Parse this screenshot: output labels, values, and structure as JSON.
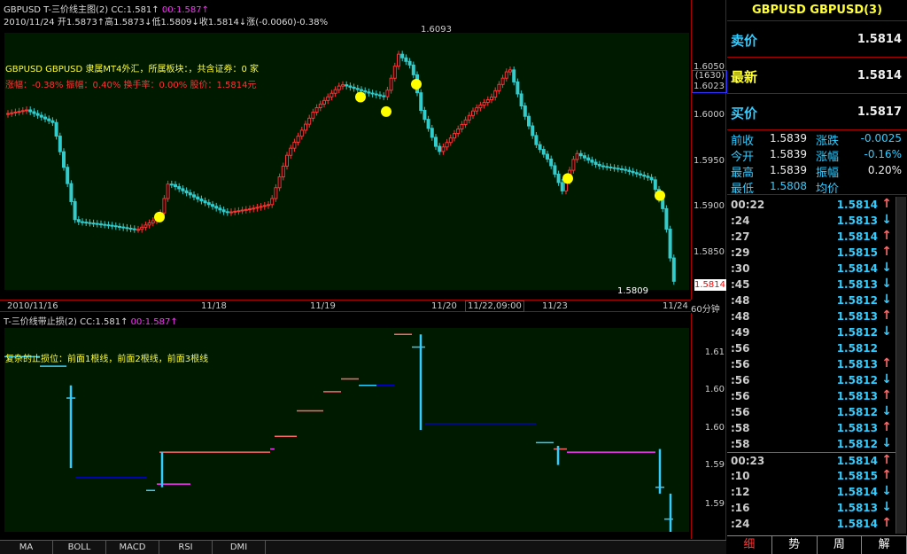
{
  "main": {
    "title": "GBPUSD T-三价线主图(2) CC:1.581↑",
    "title_cc2": "00:1.587↑",
    "ohlc": "2010/11/24 开1.5873↑高1.5873↓低1.5809↓收1.5814↓涨(-0.0060)-0.38%",
    "info_line": "GBPUSD GBPUSD 隶属MT4外汇，所属板块：，共含证券：0 家",
    "info_line2": "涨幅：-0.38% 振幅：0.40% 换手率：0.00% 股价：1.5814元",
    "high_label": "1.6093",
    "low_label": "1.5809",
    "y_ticks": [
      "1.6050",
      "1.6000",
      "1.5950",
      "1.5900",
      "1.5850"
    ],
    "y_box_top": "(1630)",
    "y_box_price": "1.6023",
    "y_current": "1.5814",
    "x_labels": [
      "2010/11/16",
      "11/18",
      "11/19",
      "11/20",
      "11/22,09:00",
      "11/23",
      "11/24"
    ],
    "period": "60分钟"
  },
  "sub": {
    "title": "T-三价线带止损(2) CC:1.581↑",
    "title_cc2": "00:1.587↑",
    "note": "复杂的止损位：前面1根线，前面2根线，前面3根线",
    "y_ticks": [
      "1.61",
      "1.60",
      "1.60",
      "1.59",
      "1.59"
    ]
  },
  "tabs": [
    "MA",
    "BOLL",
    "MACD",
    "RSI",
    "DMI"
  ],
  "right": {
    "title": "GBPUSD GBPUSD(3)",
    "sell_label": "卖价",
    "sell_val": "1.5814",
    "last_label": "最新",
    "last_val": "1.5814",
    "buy_label": "买价",
    "buy_val": "1.5817",
    "stats": [
      {
        "label": "前收",
        "value": "1.5839",
        "label2": "涨跌",
        "value2": "-0.0025"
      },
      {
        "label": "今开",
        "value": "1.5839",
        "label2": "涨幅",
        "value2": "-0.16%"
      },
      {
        "label": "最高",
        "value": "1.5839",
        "label2": "振幅",
        "value2": "0.20%"
      },
      {
        "label": "最低",
        "value": "1.5808",
        "label2": "均价",
        "value2": ""
      }
    ],
    "ticks": [
      {
        "t": "00:22",
        "p": "1.5814",
        "d": "up"
      },
      {
        "t": ":24",
        "p": "1.5813",
        "d": "down"
      },
      {
        "t": ":27",
        "p": "1.5814",
        "d": "up"
      },
      {
        "t": ":29",
        "p": "1.5815",
        "d": "up"
      },
      {
        "t": ":30",
        "p": "1.5814",
        "d": "down"
      },
      {
        "t": ":45",
        "p": "1.5813",
        "d": "down"
      },
      {
        "t": ":48",
        "p": "1.5812",
        "d": "down"
      },
      {
        "t": ":48",
        "p": "1.5813",
        "d": "up"
      },
      {
        "t": ":49",
        "p": "1.5812",
        "d": "down"
      },
      {
        "t": ":56",
        "p": "1.5812",
        "d": ""
      },
      {
        "t": ":56",
        "p": "1.5813",
        "d": "up"
      },
      {
        "t": ":56",
        "p": "1.5812",
        "d": "down"
      },
      {
        "t": ":56",
        "p": "1.5813",
        "d": "up"
      },
      {
        "t": ":56",
        "p": "1.5812",
        "d": "down"
      },
      {
        "t": ":58",
        "p": "1.5813",
        "d": "up"
      },
      {
        "t": ":58",
        "p": "1.5812",
        "d": "down"
      },
      {
        "t": "00:23",
        "p": "1.5814",
        "d": "up"
      },
      {
        "t": ":10",
        "p": "1.5815",
        "d": "up"
      },
      {
        "t": ":12",
        "p": "1.5814",
        "d": "down"
      },
      {
        "t": ":16",
        "p": "1.5813",
        "d": "down"
      },
      {
        "t": ":24",
        "p": "1.5814",
        "d": "up"
      }
    ],
    "tabs": [
      "细",
      "势",
      "周",
      "解"
    ]
  },
  "colors": {
    "up": "#ff3333",
    "down": "#33cccc",
    "frame": "#aa0000",
    "plot_bg": "#001a00"
  }
}
